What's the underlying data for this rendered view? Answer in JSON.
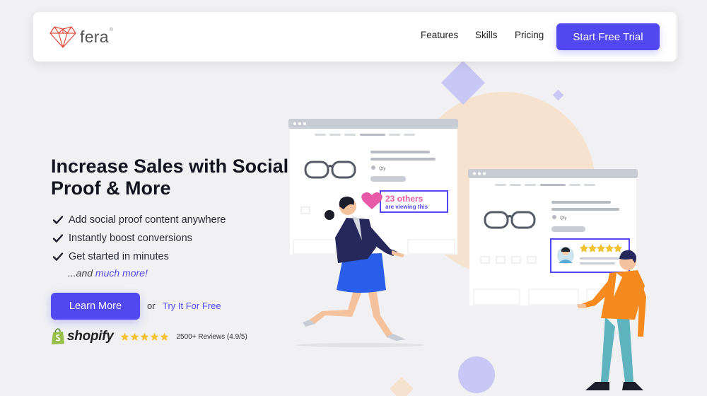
{
  "brand": {
    "name": "fera",
    "reg_mark": "®"
  },
  "nav": {
    "links": [
      "Features",
      "Skills",
      "Pricing"
    ],
    "cta_label": "Start Free Trial"
  },
  "hero": {
    "headline": "Increase Sales with Social Proof & More",
    "features": [
      "Add social proof content anywhere",
      "Instantly boost conversions",
      "Get started in minutes"
    ],
    "more_prefix": "...and ",
    "more_link": "much more!",
    "learn_more_label": "Learn More",
    "or_text": "or",
    "try_label": "Try It For Free"
  },
  "social_proof": {
    "platform": "shopify",
    "rating_stars": 5,
    "reviews_text": "2500+ Reviews (4.9/5)"
  },
  "illustration": {
    "viewing_count": "23 others",
    "viewing_text": "are viewing this",
    "qty_label": "Qty",
    "review_stars": 5
  },
  "colors": {
    "accent": "#5248f2",
    "logo_red": "#e04a3a",
    "star_gold": "#f2c230",
    "heart_pink": "#e85aa7",
    "circle_peach": "#f6e3cf",
    "diamond_lavender": "#c9c8f4",
    "shopify_green": "#95bf47"
  }
}
